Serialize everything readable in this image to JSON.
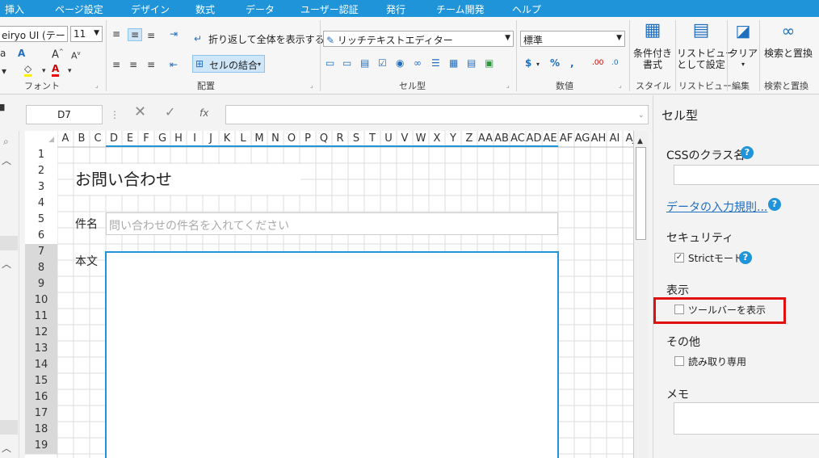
{
  "menu": {
    "items": [
      "挿入",
      "ページ設定",
      "デザイン",
      "数式",
      "データ",
      "ユーザー認証",
      "発行",
      "チーム開発",
      "ヘルプ"
    ]
  },
  "ribbon": {
    "font_name": "eiryo UI (テー",
    "font_size": "11",
    "group_font": "フォント",
    "wrap_text": "折り返して全体を表示する",
    "merge_cells": "セルの結合",
    "group_alignment": "配置",
    "celltype_combo": "リッチテキストエディター",
    "group_celltype": "セル型",
    "number_format": "標準",
    "group_number": "数値",
    "conditional_format": "条件付き\n書式",
    "group_style": "スタイル",
    "listview_set": "リストビュー\nとして設定",
    "group_listview": "リストビュー",
    "clear": "クリア",
    "group_edit": "編集",
    "find_replace": "検索と置換",
    "group_find": "検索と置換"
  },
  "formula": {
    "cell_ref": "D7",
    "content": ""
  },
  "grid": {
    "columns": [
      "A",
      "B",
      "C",
      "D",
      "E",
      "F",
      "G",
      "H",
      "I",
      "J",
      "K",
      "L",
      "M",
      "N",
      "O",
      "P",
      "Q",
      "R",
      "S",
      "T",
      "U",
      "V",
      "W",
      "X",
      "Y",
      "Z",
      "AA",
      "AB",
      "AC",
      "AD",
      "AE",
      "AF",
      "AG",
      "AH",
      "AI",
      "AJ"
    ],
    "rows": [
      "1",
      "2",
      "3",
      "4",
      "5",
      "6",
      "7",
      "8",
      "9",
      "10",
      "11",
      "12",
      "13",
      "14",
      "15",
      "16",
      "17",
      "18",
      "19"
    ],
    "title": "お問い合わせ",
    "subject_label": "件名",
    "subject_placeholder": "問い合わせの件名を入れてください",
    "body_label": "本文"
  },
  "panel": {
    "title": "セル型",
    "css_class_label": "CSSのクラス名",
    "validation_link": "データの入力規則...",
    "security_label": "セキュリティ",
    "strict_mode": "Strictモード",
    "display_label": "表示",
    "show_toolbar": "ツールバーを表示",
    "other_label": "その他",
    "readonly": "読み取り専用",
    "memo_label": "メモ"
  }
}
